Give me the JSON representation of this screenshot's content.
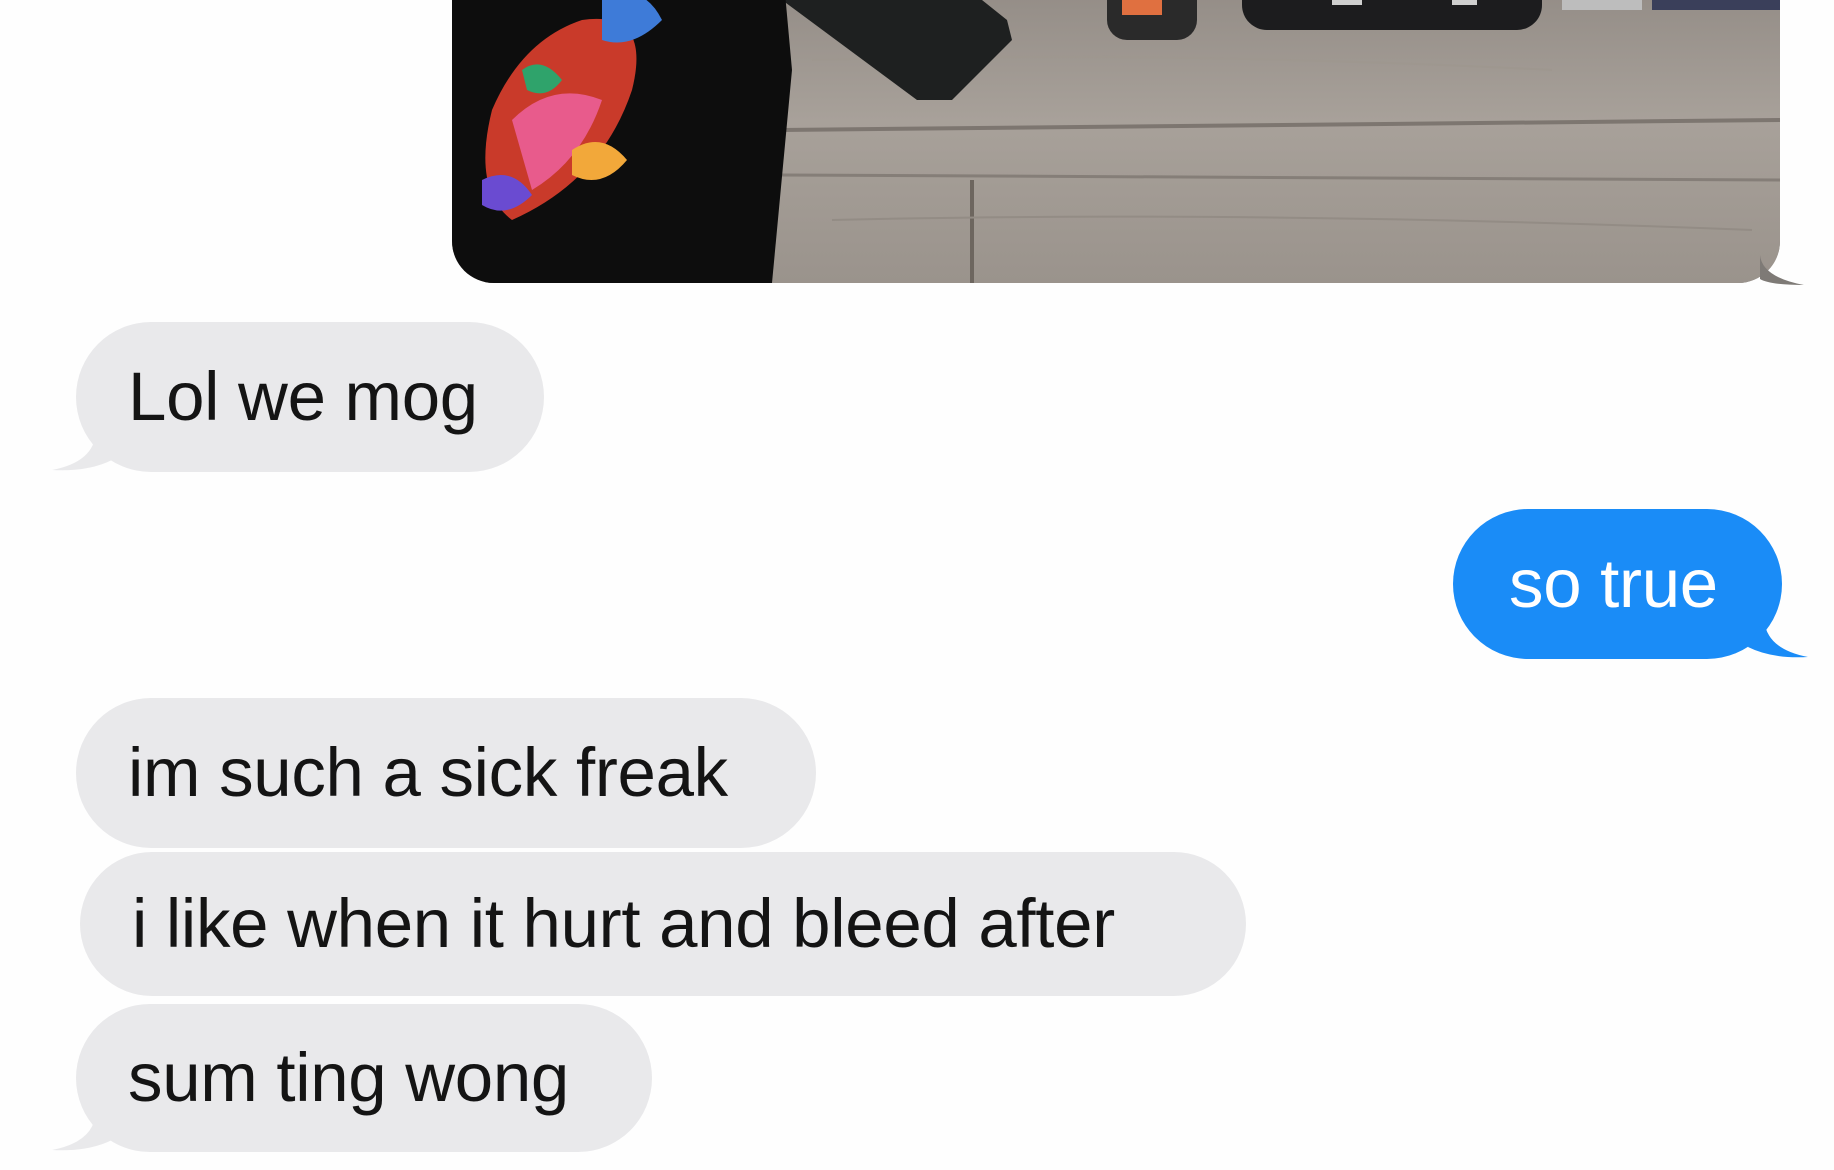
{
  "conversation": {
    "photo_message": {
      "description": "",
      "direction": "sent"
    },
    "messages": [
      {
        "text": "Lol we mog",
        "direction": "received"
      },
      {
        "text": "so true",
        "direction": "sent"
      },
      {
        "text": "im such a sick freak",
        "direction": "received"
      },
      {
        "text": "i like when it hurt and bleed after",
        "direction": "received"
      },
      {
        "text": "sum ting wong",
        "direction": "received"
      }
    ]
  },
  "colors": {
    "received_bubble": "#e9e9eb",
    "sent_bubble": "#1a8cf7",
    "received_text": "#141414",
    "sent_text": "#ffffff",
    "background": "#fefefe"
  }
}
